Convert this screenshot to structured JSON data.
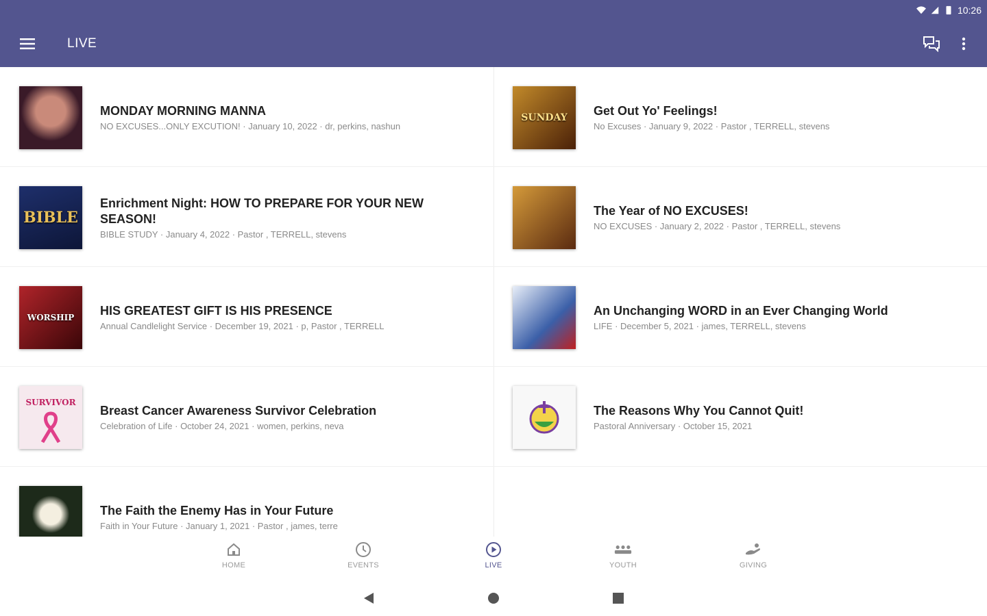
{
  "status": {
    "time": "10:26"
  },
  "appbar": {
    "title": "LIVE"
  },
  "colors": {
    "primary": "#53558f",
    "accent": "#53558f"
  },
  "items": [
    {
      "title": "MONDAY MORNING MANNA",
      "subtitle": "NO EXCUSES...ONLY EXCUTION! · January 10, 2022 · dr, perkins, nashun",
      "thumb_bg": "#5a2a3a"
    },
    {
      "title": "Get Out Yo' Feelings!",
      "subtitle": "No Excuses · January 9, 2022 · Pastor , TERRELL, stevens",
      "thumb_bg": "#6b3a12",
      "thumb_text": "SUNDAY"
    },
    {
      "title": "Enrichment Night: HOW TO PREPARE FOR YOUR NEW SEASON!",
      "subtitle": "BIBLE STUDY · January 4, 2022 · Pastor , TERRELL, stevens",
      "thumb_bg": "#1e2f6b",
      "thumb_text": "BIBLE"
    },
    {
      "title": "The Year of NO EXCUSES!",
      "subtitle": "NO EXCUSES · January 2, 2022 · Pastor , TERRELL, stevens",
      "thumb_bg": "#7a4a14"
    },
    {
      "title": "HIS GREATEST GIFT IS HIS PRESENCE",
      "subtitle": "Annual Candlelight Service · December 19, 2021 · p, Pastor , TERRELL",
      "thumb_bg": "#8c1a1e",
      "thumb_text": "WORSHIP"
    },
    {
      "title": "An Unchanging WORD in an Ever Changing World",
      "subtitle": "LIFE · December 5, 2021 · james, TERRELL, stevens",
      "thumb_bg": "#3b5fa8"
    },
    {
      "title": "Breast Cancer Awareness Survivor Celebration",
      "subtitle": "Celebration of Life · October 24, 2021 · women, perkins, neva",
      "thumb_bg": "#f6e9ee",
      "thumb_text": "SURVIVOR"
    },
    {
      "title": "The Reasons Why You Cannot Quit!",
      "subtitle": "Pastoral Anniversary · October 15, 2021",
      "thumb_bg": "#f4f4f4"
    },
    {
      "title": "The Faith the Enemy Has in Your Future",
      "subtitle": "Faith in Your Future · January 1, 2021 · Pastor , james, terre",
      "thumb_bg": "#1d2a1a"
    }
  ],
  "bottom_nav": [
    {
      "label": "HOME",
      "icon": "home-icon"
    },
    {
      "label": "EVENTS",
      "icon": "clock-icon"
    },
    {
      "label": "LIVE",
      "icon": "play-circle-icon",
      "active": true
    },
    {
      "label": "YOUTH",
      "icon": "group-icon"
    },
    {
      "label": "GIVING",
      "icon": "giving-hand-icon"
    }
  ]
}
